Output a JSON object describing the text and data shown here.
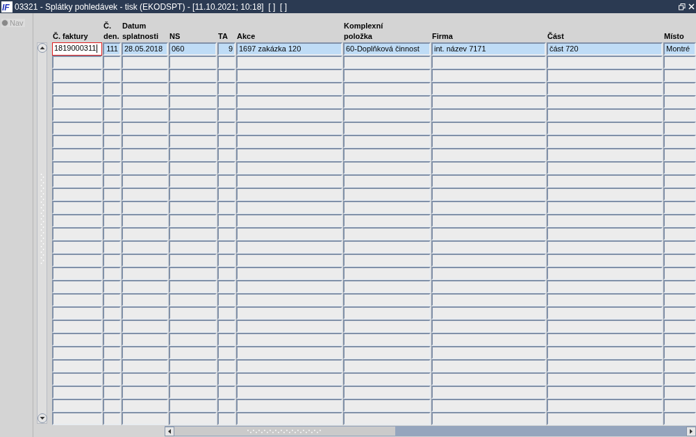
{
  "window": {
    "logo": "IF",
    "title": "03321 - Splátky pohledávek - tisk (EKODSPT) - [11.10.2021; 10:18]  [ ]  [ ]"
  },
  "sidebar": {
    "nav": {
      "label": "Nav",
      "selected": false
    }
  },
  "table": {
    "columns": [
      {
        "label": "Č. faktury"
      },
      {
        "label": "Č.\nden."
      },
      {
        "label": "Datum\nsplatnosti"
      },
      {
        "label": "NS"
      },
      {
        "label": "TA"
      },
      {
        "label": "Akce"
      },
      {
        "label": "Komplexní\npoložka"
      },
      {
        "label": "Firma"
      },
      {
        "label": "Část"
      },
      {
        "label": "Místo"
      }
    ],
    "rows": [
      {
        "selected": true,
        "cells": [
          {
            "text": "1819000311",
            "focused": true,
            "numeric": false
          },
          {
            "text": "111",
            "focused": false,
            "numeric": true
          },
          {
            "text": "28.05.2018",
            "focused": false,
            "numeric": false
          },
          {
            "text": "060",
            "focused": false,
            "numeric": false
          },
          {
            "text": "9",
            "focused": false,
            "numeric": true
          },
          {
            "text": "1697 zakázka 120",
            "focused": false,
            "numeric": false
          },
          {
            "text": "60-Doplňková činnost",
            "focused": false,
            "numeric": false
          },
          {
            "text": "int. název 7171",
            "focused": false,
            "numeric": false
          },
          {
            "text": "část 720",
            "focused": false,
            "numeric": false
          },
          {
            "text": "Montré",
            "focused": false,
            "numeric": false
          }
        ]
      },
      {
        "selected": false
      },
      {
        "selected": false
      },
      {
        "selected": false
      },
      {
        "selected": false
      },
      {
        "selected": false
      },
      {
        "selected": false
      },
      {
        "selected": false
      },
      {
        "selected": false
      },
      {
        "selected": false
      },
      {
        "selected": false
      },
      {
        "selected": false
      },
      {
        "selected": false
      },
      {
        "selected": false
      },
      {
        "selected": false
      },
      {
        "selected": false
      },
      {
        "selected": false
      },
      {
        "selected": false
      },
      {
        "selected": false
      },
      {
        "selected": false
      },
      {
        "selected": false
      },
      {
        "selected": false
      },
      {
        "selected": false
      },
      {
        "selected": false
      },
      {
        "selected": false
      },
      {
        "selected": false
      },
      {
        "selected": false
      },
      {
        "selected": false
      },
      {
        "selected": false
      }
    ]
  }
}
